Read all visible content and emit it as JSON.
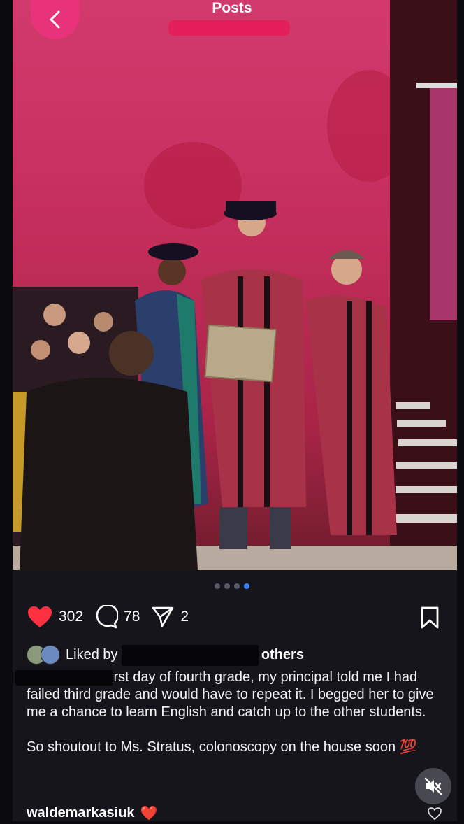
{
  "header": {
    "title": "Posts"
  },
  "post": {
    "carousel": {
      "count": 4,
      "active_index": 3
    },
    "likes": "302",
    "comments": "78",
    "shares": "2",
    "liked_by": {
      "prefix": "Liked by ",
      "suffix": "d others"
    },
    "caption": "irst day of fourth grade, my principal told me I had failed third grade and would have to repeat it. I begged her to give me a chance to learn English and catch up to the other students.\n\nSo shoutout to Ms. Stratus, colonoscopy on the house soon ",
    "caption_emoji": "💯",
    "first_comment": {
      "username": "waldemarkasiuk",
      "emoji": "❤️"
    }
  },
  "colors": {
    "like": "#ff3040",
    "accent_back": "#e8337a",
    "active_dot": "#3b82f6",
    "background": "#15151b"
  },
  "icons": [
    "chevron-left-icon",
    "heart-icon",
    "comment-icon",
    "share-icon",
    "bookmark-icon",
    "mute-icon",
    "heart-outline-icon"
  ]
}
